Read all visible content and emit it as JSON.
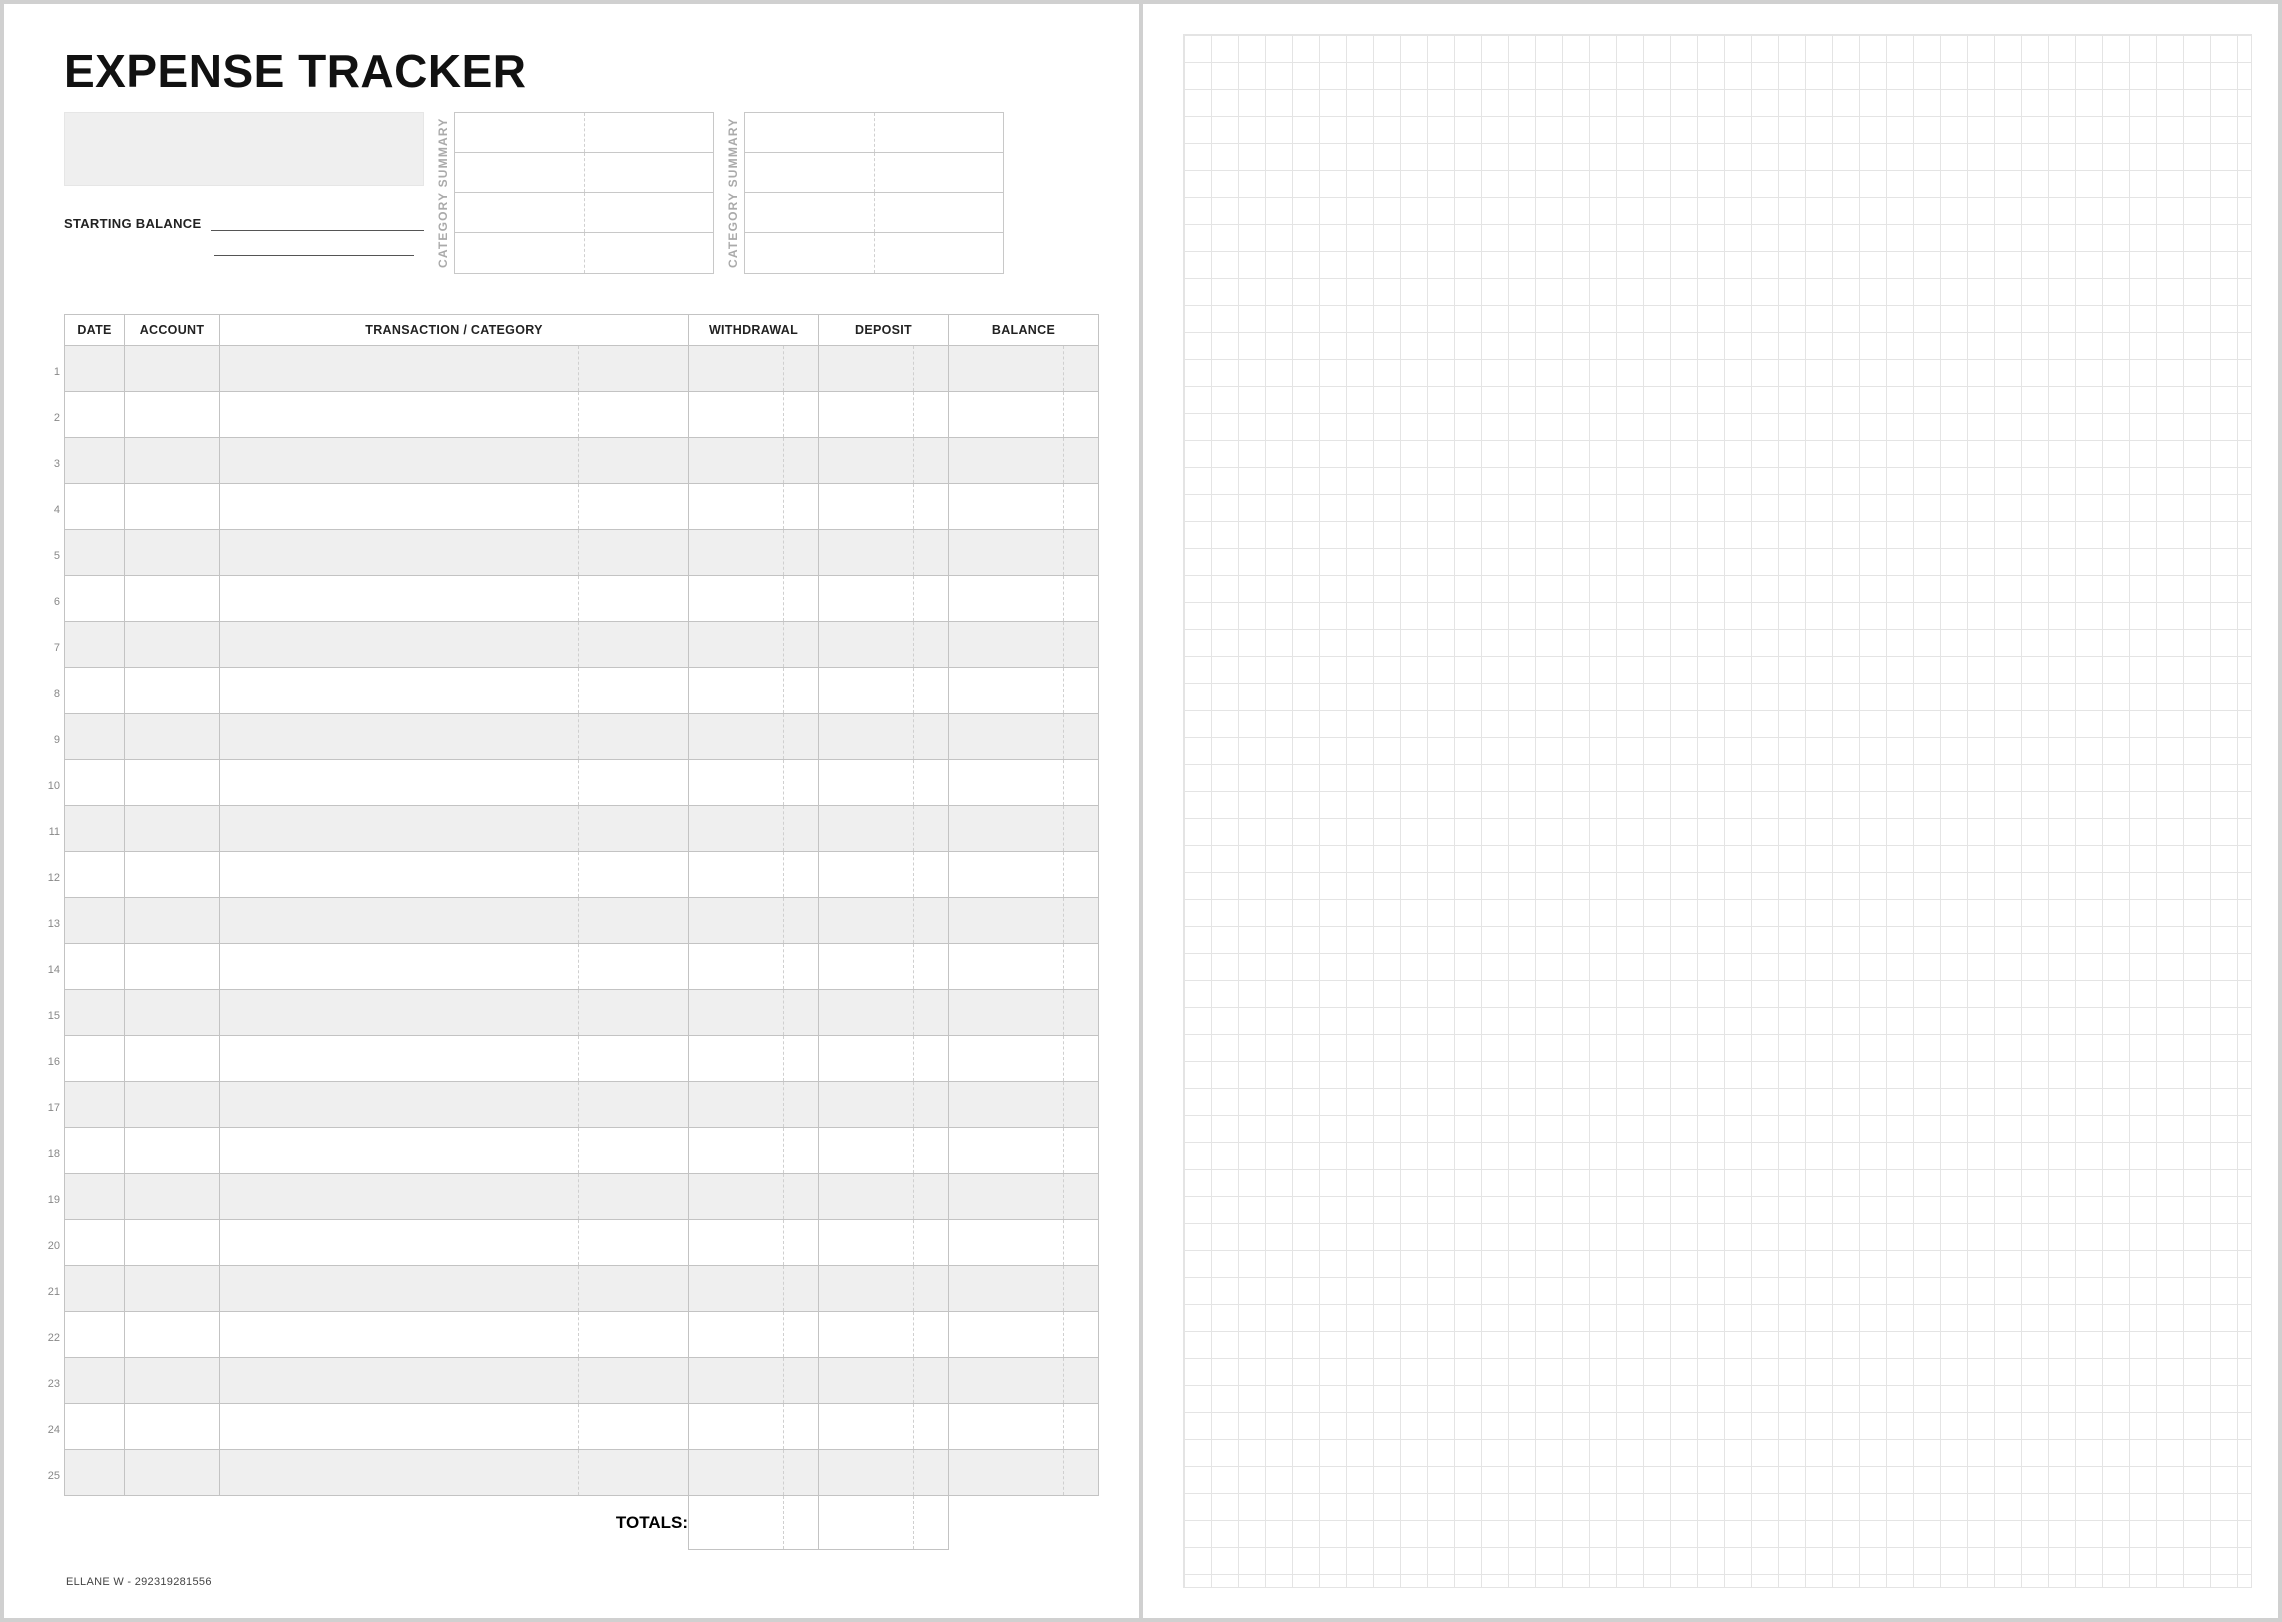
{
  "title": "EXPENSE TRACKER",
  "starting_balance_label": "STARTING BALANCE",
  "category_summary_label": "CATEGORY SUMMARY",
  "ledger": {
    "headers": {
      "date": "DATE",
      "account": "ACCOUNT",
      "transaction": "TRANSACTION / CATEGORY",
      "withdrawal": "WITHDRAWAL",
      "deposit": "DEPOSIT",
      "balance": "BALANCE"
    },
    "row_count": 25,
    "totals_label": "TOTALS:"
  },
  "footer": {
    "author": "ELLANE W",
    "separator": " - ",
    "code": "292319281556"
  }
}
